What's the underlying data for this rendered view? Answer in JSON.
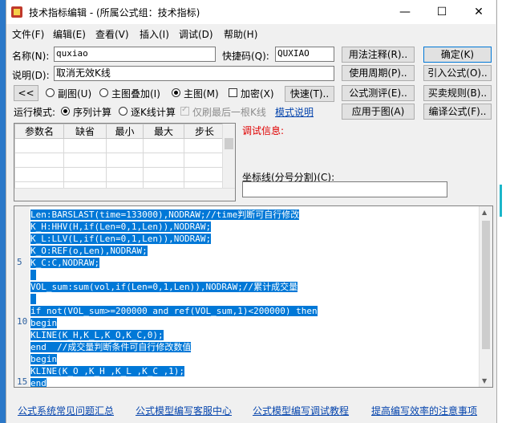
{
  "window": {
    "title": "技术指标编辑 - (所属公式组：技术指标)",
    "minimize": "—",
    "maximize": "☐",
    "close": "✕"
  },
  "menu": [
    "文件(F)",
    "编辑(E)",
    "查看(V)",
    "插入(I)",
    "调试(D)",
    "帮助(H)"
  ],
  "form": {
    "name_label": "名称(N):",
    "name_value": "quxiao",
    "shortcut_label": "快捷码(Q):",
    "shortcut_value": "QUXIAO",
    "desc_label": "说明(D):",
    "desc_value": "取消无效K线",
    "prev_button": "<<",
    "radio_sub": "副图(U)",
    "radio_overlay": "主图叠加(I)",
    "radio_main": "主图(M)",
    "encrypt_label": "加密(X)",
    "quick_button": "快速(T)..",
    "run_mode_label": "运行模式:",
    "radio_sequence": "序列计算",
    "radio_bybar": "逐K线计算",
    "last_bar_label": "仅刷最后一根K线",
    "mode_help_link": "模式说明"
  },
  "buttons": {
    "usage": "用法注释(R)..",
    "confirm": "确定(K)",
    "period": "使用周期(P)..",
    "import": "引入公式(O)..",
    "test": "公式测评(E)..",
    "trade_rules": "买卖规则(B)..",
    "apply": "应用于图(A)",
    "compile": "编译公式(F).."
  },
  "params": {
    "columns": [
      "参数名",
      "缺省",
      "最小",
      "最大",
      "步长"
    ],
    "rows": [
      [
        "",
        "",
        "",
        "",
        ""
      ],
      [
        "",
        "",
        "",
        "",
        ""
      ],
      [
        "",
        "",
        "",
        "",
        ""
      ],
      [
        "",
        "",
        "",
        "",
        ""
      ]
    ]
  },
  "debug": {
    "title": "调试信息:",
    "coord_label": "坐标线(分号分割)(C):",
    "coord_value": ""
  },
  "editor": {
    "line_numbers": [
      {
        "n": "5",
        "line": 5
      },
      {
        "n": "10",
        "line": 10
      },
      {
        "n": "15",
        "line": 15
      }
    ],
    "lines": [
      "Len:BARSLAST(time=133000),NODRAW;//time判断可自行修改",
      "K_H:HHV(H,if(Len=0,1,Len)),NODRAW;",
      "K_L:LLV(L,if(Len=0,1,Len)),NODRAW;",
      "K_O:REF(o,Len),NODRAW;",
      "K_C:C,NODRAW;",
      "",
      "VOL_sum:sum(vol,if(Len=0,1,Len)),NODRAW;//累计成交量",
      "",
      "if not(VOL_sum>=200000 and ref(VOL_sum,1)<200000) then",
      "begin",
      "KLINE(K_H,K_L,K_O,K_C,0);",
      "end  //成交量判断条件可自行修改数值",
      "begin",
      "KLINE(K_O ,K_H ,K_L ,K_C ,1);",
      "end"
    ]
  },
  "footer": [
    "公式系统常见问题汇总",
    "公式模型编写客服中心",
    "公式模型编写调试教程",
    "提高编写效率的注意事项"
  ],
  "colors": {
    "selection": "#0078d7",
    "link": "#0645ad",
    "debug_title": "#e00000"
  }
}
